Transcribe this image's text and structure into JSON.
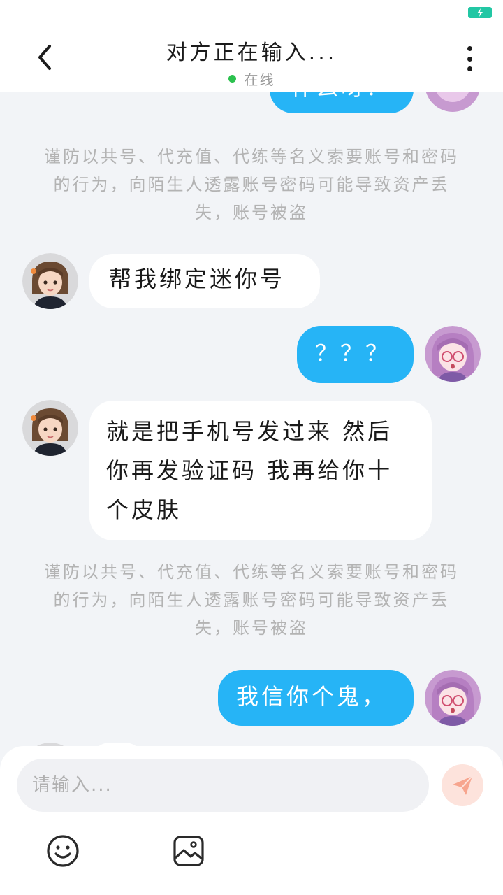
{
  "header": {
    "title": "对方正在输入...",
    "status": "在线"
  },
  "messages": {
    "partial_top": "什么呀？",
    "notice_1": "谨防以共号、代充值、代练等名义索要账号和密码的行为，向陌生人透露账号密码可能导致资产丢失，账号被盗",
    "msg_1": "帮我绑定迷你号",
    "msg_2": "？？？",
    "msg_3": "就是把手机号发过来 然后你再发验证码 我再给你十个皮肤",
    "notice_2": "谨防以共号、代充值、代练等名义索要账号和密码的行为，向陌生人透露账号密码可能导致资产丢失，账号被盗",
    "msg_4": "我信你个鬼，"
  },
  "composer": {
    "placeholder": "请输入..."
  },
  "colors": {
    "accent": "#26b4f6",
    "online": "#2bc14e",
    "send_bg": "#fde3dc",
    "send_icon": "#f7a58e"
  },
  "icons": [
    "battery-charging-icon",
    "back-arrow-icon",
    "more-vertical-icon",
    "send-icon",
    "emoji-icon",
    "image-icon"
  ]
}
